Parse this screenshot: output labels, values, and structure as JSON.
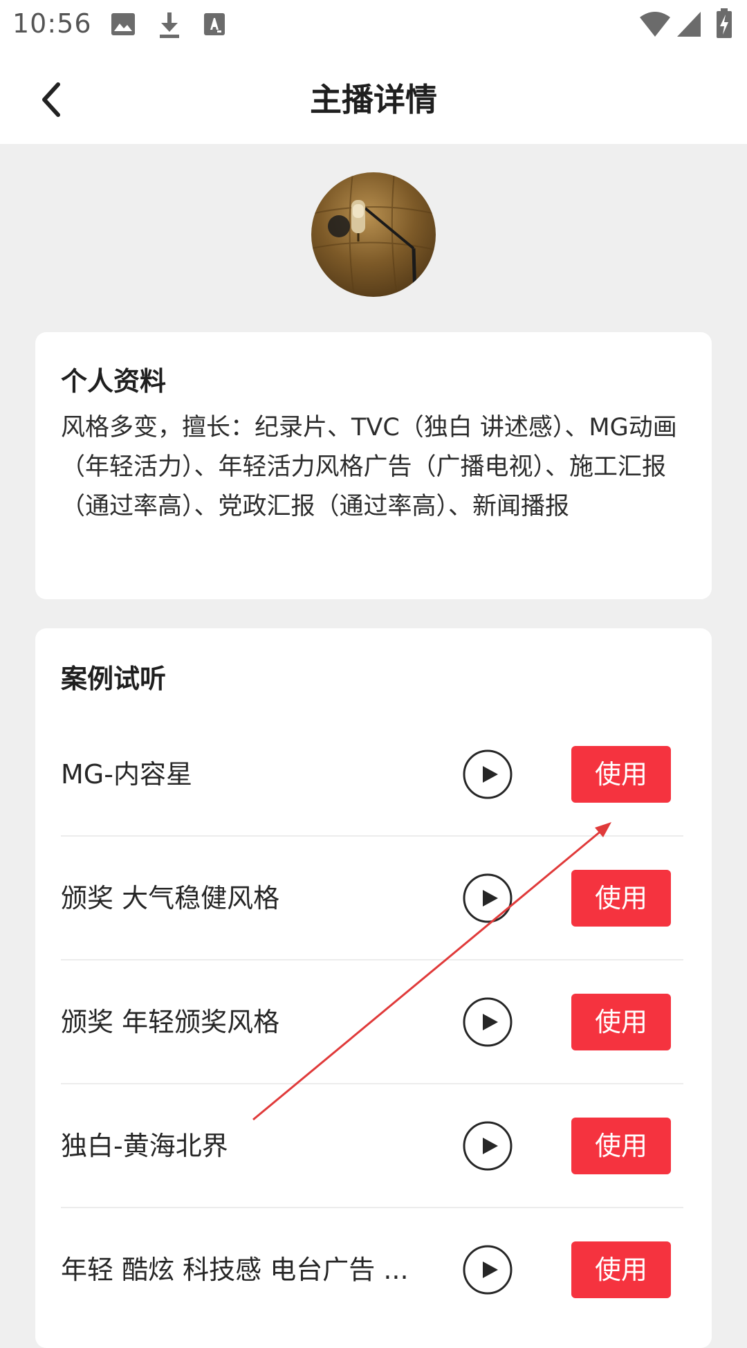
{
  "status_bar": {
    "time": "10:56",
    "icons": [
      "image-icon",
      "download-icon",
      "text-a-icon",
      "wifi-icon",
      "cell-signal-icon",
      "battery-charging-icon"
    ]
  },
  "app_bar": {
    "title": "主播详情",
    "back_icon": "chevron-left-icon"
  },
  "profile": {
    "title": "个人资料",
    "description": "风格多变，擅长：纪录片、TVC（独白 讲述感）、MG动画（年轻活力）、年轻活力风格广告（广播电视）、施工汇报（通过率高）、党政汇报（通过率高）、新闻播报"
  },
  "cases": {
    "title": "案例试听",
    "use_label": "使用",
    "play_icon": "play-circle-icon",
    "items": [
      {
        "name": "MG-内容星"
      },
      {
        "name": "颁奖 大气稳健风格"
      },
      {
        "name": "颁奖 年轻颁奖风格"
      },
      {
        "name": "独白-黄海北界"
      },
      {
        "name": "年轻 酷炫 科技感 电台广告 ..."
      }
    ]
  },
  "colors": {
    "accent": "#f5333f",
    "background": "#efefef",
    "card": "#ffffff",
    "annotation": "#e03a3a"
  }
}
